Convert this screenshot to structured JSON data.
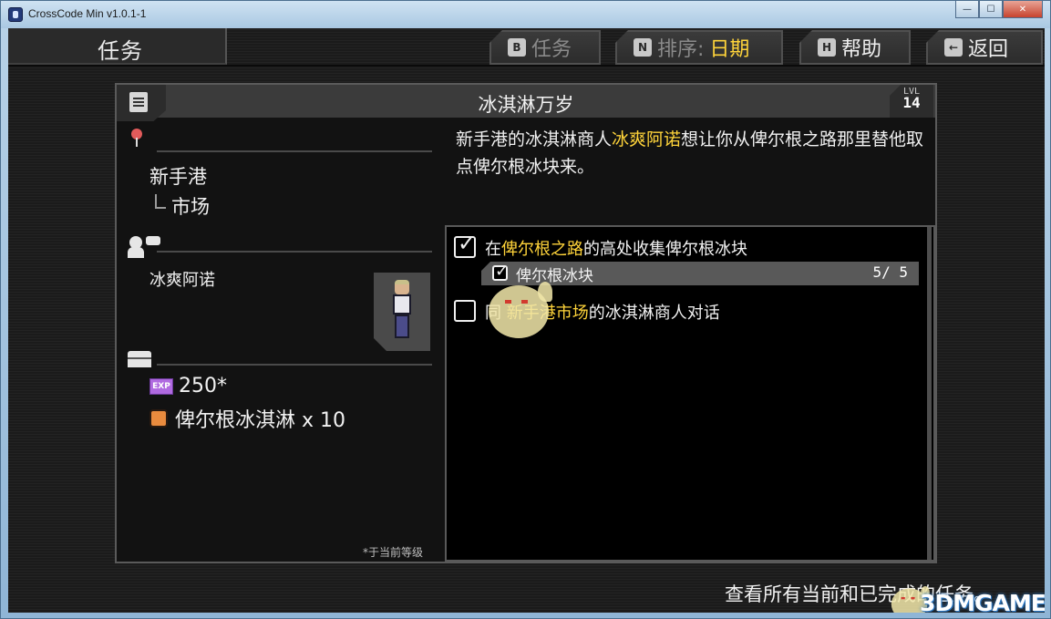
{
  "window": {
    "title": "CrossCode Min v1.0.1-1",
    "buttons": {
      "minimize": "—",
      "maximize": "☐",
      "close": "✕"
    }
  },
  "header": {
    "title": "任务",
    "buttons": [
      {
        "key": "B",
        "label": "任务",
        "value": ""
      },
      {
        "key": "N",
        "label": "排序:",
        "value": "日期"
      },
      {
        "key": "H",
        "label": "帮助",
        "value": ""
      },
      {
        "key": "←",
        "label": "返回",
        "value": ""
      }
    ]
  },
  "quest": {
    "title": "冰淇淋万岁",
    "level_label": "LVL",
    "level": "14",
    "description": {
      "part1": "新手港的冰淇淋商人",
      "highlight": "冰爽阿诺",
      "part2": "想让你从俾尔根之路那里替他取点俾尔根冰块来。"
    },
    "location": {
      "main": "新手港",
      "sub": "市场"
    },
    "npc": {
      "name": "冰爽阿诺"
    },
    "rewards": {
      "exp_icon": "EXP",
      "exp": "250*",
      "item": "俾尔根冰淇淋 x 10"
    },
    "footnote": "*于当前等级",
    "objectives": [
      {
        "pre": "在",
        "highlight": "俾尔根之路",
        "post": "的高处收集俾尔根冰块",
        "checked": true
      },
      {
        "sub_label": "俾尔根冰块",
        "count": "5/ 5",
        "checked": true
      },
      {
        "pre": "同",
        "highlight": "新手港市场",
        "post": "的冰淇淋商人对话",
        "checked": false
      }
    ]
  },
  "footer": {
    "text": "查看所有当前和已完成的任务。"
  },
  "watermark": "3DMGAME",
  "icons": {
    "scroll": "scroll-icon",
    "pin": "map-pin-icon",
    "npc": "npc-speech-icon",
    "chest": "chest-icon",
    "exp": "exp-icon",
    "item": "ice-cream-item-icon",
    "checkbox": "checkbox-icon"
  },
  "colors": {
    "highlight": "#ffd43a",
    "background": "#1b1b1b",
    "panel_border": "#5a5a5a"
  }
}
